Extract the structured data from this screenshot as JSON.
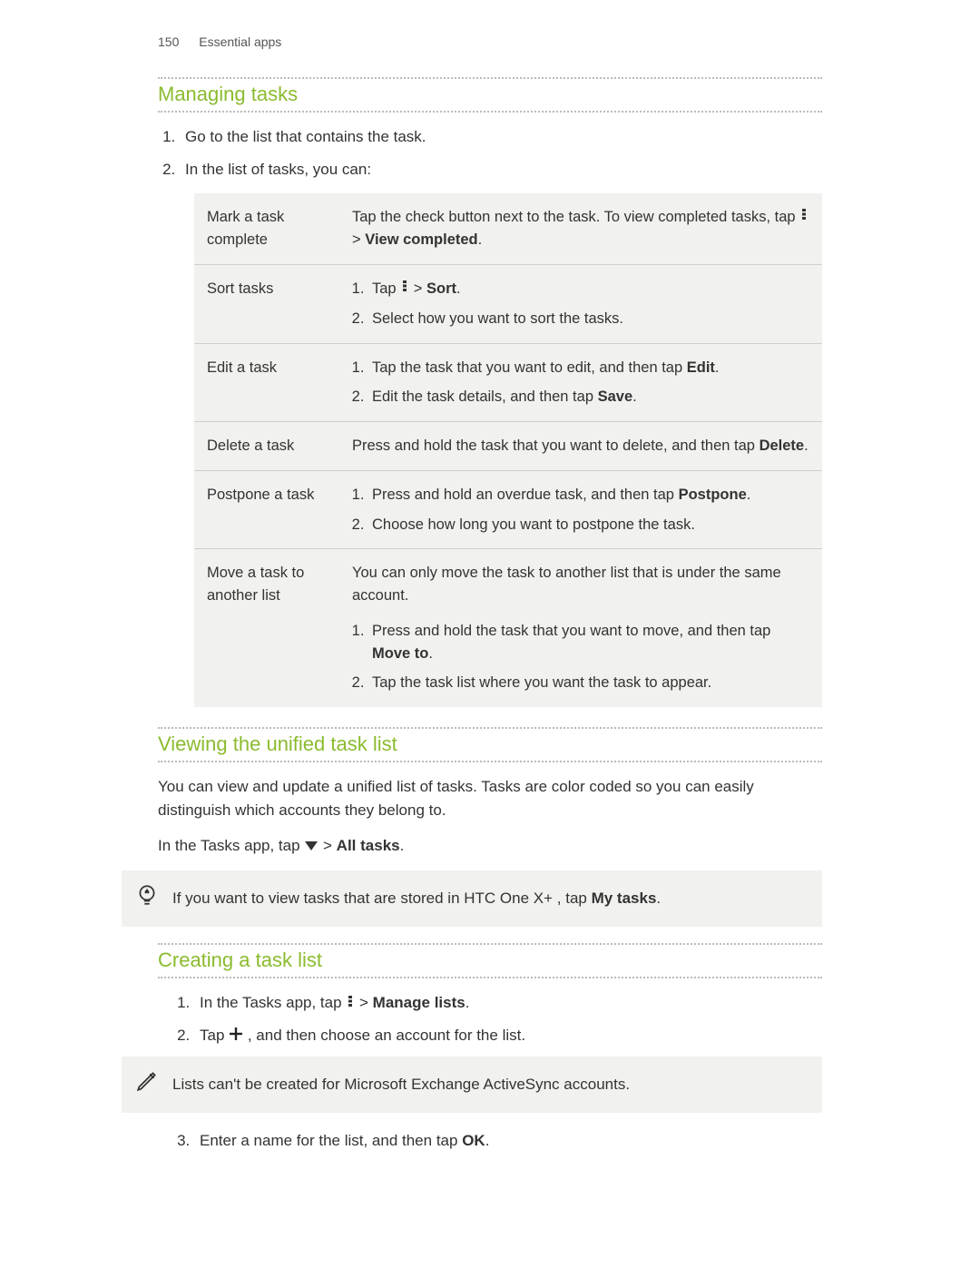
{
  "header": {
    "page_number": "150",
    "section": "Essential apps"
  },
  "s1": {
    "title": "Managing tasks",
    "step1": "Go to the list that contains the task.",
    "step2": "In the list of tasks, you can:",
    "rows": {
      "r0": {
        "label": "Mark a task complete",
        "text_a": "Tap the check button next to the task. To view completed tasks, tap ",
        "text_b": " > ",
        "bold": "View completed",
        "text_c": "."
      },
      "r1": {
        "label": "Sort tasks",
        "li1a": "Tap ",
        "li1b": " > ",
        "li1bold": "Sort",
        "li1c": ".",
        "li2": "Select how you want to sort the tasks."
      },
      "r2": {
        "label": "Edit a task",
        "li1a": "Tap the task that you want to edit, and then tap ",
        "li1bold": "Edit",
        "li1c": ".",
        "li2a": "Edit the task details, and then tap ",
        "li2bold": "Save",
        "li2c": "."
      },
      "r3": {
        "label": "Delete a task",
        "text_a": "Press and hold the task that you want to delete, and then tap ",
        "bold": "Delete",
        "text_b": "."
      },
      "r4": {
        "label": "Postpone a task",
        "li1a": "Press and hold an overdue task, and then tap ",
        "li1bold": "Postpone",
        "li1c": ".",
        "li2": "Choose how long you want to postpone the task."
      },
      "r5": {
        "label": "Move a task to another list",
        "intro": "You can only move the task to another list that is under the same account.",
        "li1a": "Press and hold the task that you want to move, and then tap ",
        "li1bold": "Move to",
        "li1c": ".",
        "li2": "Tap the task list where you want the task to appear."
      }
    }
  },
  "s2": {
    "title": "Viewing the unified task list",
    "p1": "You can view and update a unified list of tasks. Tasks are color coded so you can easily distinguish which accounts they belong to.",
    "p2a": "In the Tasks app, tap ",
    "p2b": " > ",
    "p2bold": "All tasks",
    "p2c": ".",
    "tip_a": "If you want to view tasks that are stored in HTC One X+ , tap ",
    "tip_bold": "My tasks",
    "tip_c": "."
  },
  "s3": {
    "title": "Creating a task list",
    "li1a": "In the Tasks app, tap ",
    "li1b": " > ",
    "li1bold": "Manage lists",
    "li1c": ".",
    "li2a": "Tap ",
    "li2b": " , and then choose an account for the list.",
    "note": "Lists can't be created for Microsoft Exchange ActiveSync accounts.",
    "li3a": "Enter a name for the list, and then tap ",
    "li3bold": "OK",
    "li3c": "."
  }
}
